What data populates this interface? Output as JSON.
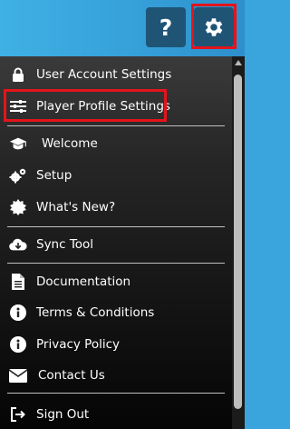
{
  "toolbar": {
    "help_label": "?",
    "help_icon": "question-mark-icon",
    "settings_icon": "gear-icon",
    "highlight_color": "#e4141b"
  },
  "menu": {
    "items": [
      {
        "label": "User Account Settings",
        "icon": "lock-icon"
      },
      {
        "label": "Player Profile Settings",
        "icon": "sliders-icon"
      },
      {
        "label": "Welcome",
        "icon": "graduation-cap-icon"
      },
      {
        "label": "Setup",
        "icon": "cogs-icon"
      },
      {
        "label": "What's New?",
        "icon": "certificate-icon"
      },
      {
        "label": "Sync Tool",
        "icon": "cloud-download-icon"
      },
      {
        "label": "Documentation",
        "icon": "document-icon"
      },
      {
        "label": "Terms & Conditions",
        "icon": "info-icon"
      },
      {
        "label": "Privacy Policy",
        "icon": "info-icon"
      },
      {
        "label": "Contact Us",
        "icon": "envelope-icon"
      },
      {
        "label": "Sign Out",
        "icon": "sign-out-icon"
      }
    ]
  }
}
